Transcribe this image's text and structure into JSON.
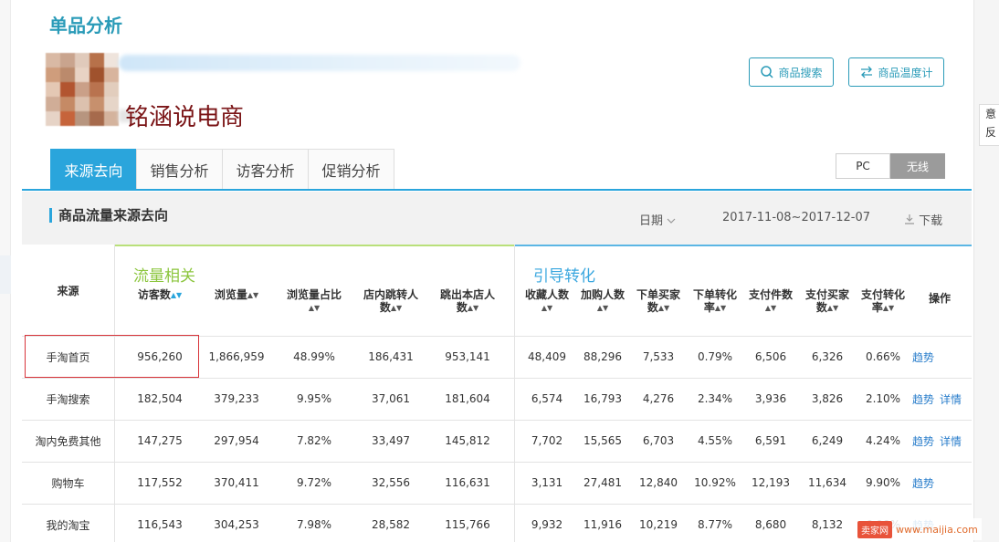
{
  "page_title": "单品分析",
  "watermark_text": "铭涵说电商",
  "buttons": {
    "product_search": "商品搜索",
    "temperature": "商品温度计"
  },
  "tabs": [
    "来源去向",
    "销售分析",
    "访客分析",
    "促销分析"
  ],
  "device_toggle": {
    "pc": "PC",
    "wireless": "无线",
    "selected": "无线"
  },
  "section": {
    "title": "商品流量来源去向",
    "date_label": "日期",
    "date_range": "2017-11-08~2017-12-07",
    "download": "下载"
  },
  "side_feedback": {
    "line1": "意",
    "line2": "反"
  },
  "table": {
    "source_header": "来源",
    "group_traffic": "流量相关",
    "group_conversion": "引导转化",
    "columns": [
      {
        "line1": "访客数",
        "line2": ""
      },
      {
        "line1": "浏览量",
        "line2": ""
      },
      {
        "line1": "浏览量占比",
        "line2": ""
      },
      {
        "line1": "店内跳转人",
        "line2": "数"
      },
      {
        "line1": "跳出本店人",
        "line2": "数"
      },
      {
        "line1": "收藏人数",
        "line2": ""
      },
      {
        "line1": "加购人数",
        "line2": ""
      },
      {
        "line1": "下单买家",
        "line2": "数"
      },
      {
        "line1": "下单转化",
        "line2": "率"
      },
      {
        "line1": "支付件数",
        "line2": ""
      },
      {
        "line1": "支付买家",
        "line2": "数"
      },
      {
        "line1": "支付转化",
        "line2": "率"
      }
    ],
    "ops_header": "操作",
    "rows": [
      {
        "source": "手淘首页",
        "values": [
          "956,260",
          "1,866,959",
          "48.99%",
          "186,431",
          "953,141",
          "48,409",
          "88,296",
          "7,533",
          "0.79%",
          "6,506",
          "6,326",
          "0.66%"
        ],
        "ops": [
          "趋势"
        ]
      },
      {
        "source": "手淘搜索",
        "values": [
          "182,504",
          "379,233",
          "9.95%",
          "37,061",
          "181,604",
          "6,574",
          "16,793",
          "4,276",
          "2.34%",
          "3,936",
          "3,826",
          "2.10%"
        ],
        "ops": [
          "趋势",
          "详情"
        ]
      },
      {
        "source": "淘内免费其他",
        "values": [
          "147,275",
          "297,954",
          "7.82%",
          "33,497",
          "145,812",
          "7,702",
          "15,565",
          "6,703",
          "4.55%",
          "6,591",
          "6,249",
          "4.24%"
        ],
        "ops": [
          "趋势",
          "详情"
        ]
      },
      {
        "source": "购物车",
        "values": [
          "117,552",
          "370,411",
          "9.72%",
          "32,556",
          "116,631",
          "3,131",
          "27,481",
          "12,840",
          "10.92%",
          "12,193",
          "11,634",
          "9.90%"
        ],
        "ops": [
          "趋势"
        ]
      },
      {
        "source": "我的淘宝",
        "values": [
          "116,543",
          "304,253",
          "7.98%",
          "28,582",
          "115,766",
          "9,932",
          "11,916",
          "10,219",
          "8.77%",
          "8,680",
          "8,132",
          "6.98%"
        ],
        "ops": [
          "趋势"
        ]
      }
    ]
  },
  "site_watermark": {
    "logo": "卖家网",
    "url": "www.maijia.com"
  },
  "colors": {
    "accent": "#2aa5dc",
    "traffic_green": "#8cc63e",
    "conversion_blue": "#3aa7df",
    "link": "#2a7ecb",
    "highlight_red": "#d8343a"
  }
}
